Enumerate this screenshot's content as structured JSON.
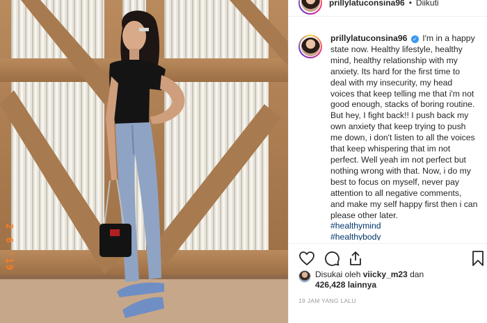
{
  "header": {
    "username": "prillylatuconsina96",
    "separator": "•",
    "follow_status": "Diikuti"
  },
  "photo": {
    "date_stamp": "2 6 '19"
  },
  "caption": {
    "username": "prillylatuconsina96",
    "verified_mark": "✓",
    "text": "I'm in a happy state now. Healthy lifestyle, healthy mind, healthy relationship with my anxiety. Its hard for the first time to deal with my insecurity, my head voices that keep telling me that i'm not good enough, stacks of boring routine. But hey, I fight back!! I push back my own anxiety that keep trying to push me down, i don't listen to all the voices that keep whispering that im not perfect. Well yeah im not perfect but nothing wrong with that. Now, i do my best to focus on myself, never pay attention to all negative comments, and make my self happy first then i can please other later.",
    "hashtags": [
      "#healthymind",
      "#healthybody"
    ]
  },
  "actions": {
    "like": "heart-icon",
    "comment": "comment-icon",
    "share": "share-icon",
    "save": "bookmark-icon"
  },
  "likes": {
    "prefix": "Disukai oleh",
    "user": "viicky_m23",
    "joiner": "dan",
    "count": "426,428",
    "suffix": "lainnya"
  },
  "timestamp": "19 JAM YANG LALU",
  "colors": {
    "link": "#003569",
    "verified": "#3897f0",
    "text": "#262626",
    "muted": "#999999",
    "stamp": "#ff7b1e"
  }
}
